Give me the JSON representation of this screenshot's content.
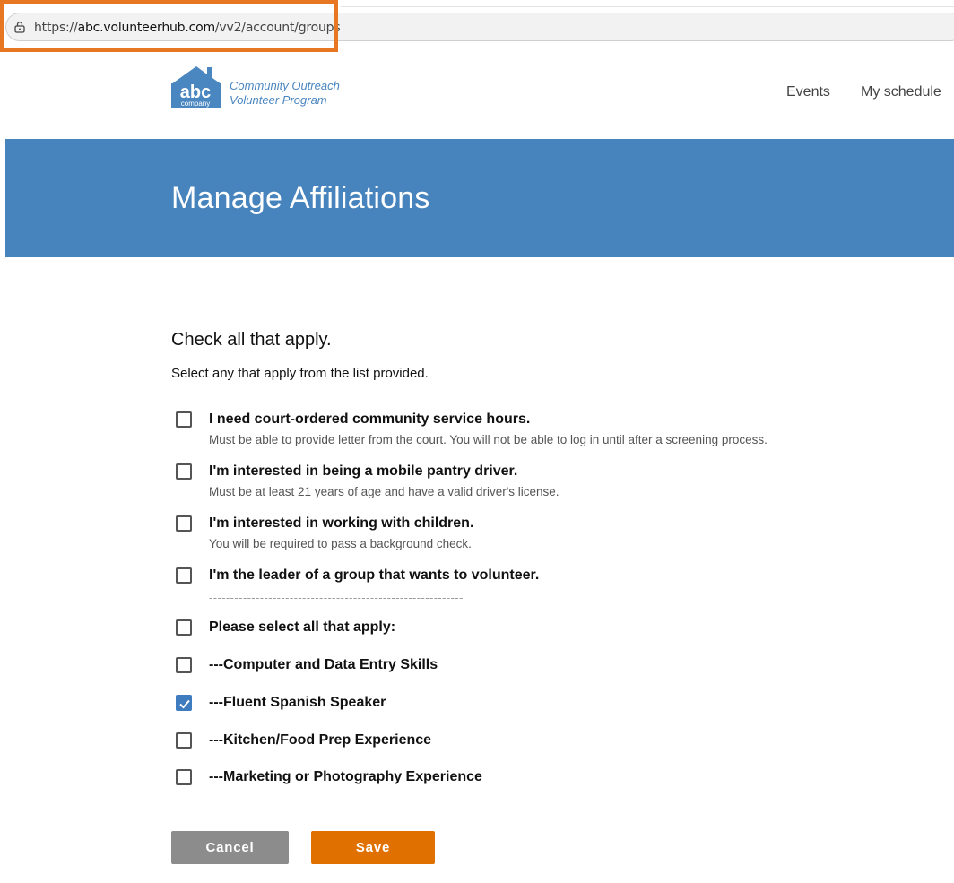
{
  "browser": {
    "url_prefix": "https://",
    "url_domain": "abc.volunteerhub.com",
    "url_path": "/vv2/account/groups",
    "lock_icon": "lock-icon"
  },
  "header": {
    "logo_text_top": "abc",
    "logo_text_bottom": "company",
    "brand_line1": "Community Outreach",
    "brand_line2": "Volunteer Program",
    "nav": [
      {
        "label": "Events"
      },
      {
        "label": "My schedule"
      }
    ]
  },
  "banner": {
    "title": "Manage Affiliations"
  },
  "form": {
    "heading": "Check all that apply.",
    "subtext": "Select any that apply from the list provided.",
    "options": [
      {
        "label": "I need court-ordered community service hours.",
        "hint": "Must be able to provide letter from the court. You will not be able to log in until after a screening process.",
        "checked": false
      },
      {
        "label": "I'm interested in being a mobile pantry driver.",
        "hint": "Must be at least 21 years of age and have a valid driver's license.",
        "checked": false
      },
      {
        "label": "I'm interested in working with children.",
        "hint": "You will be required to pass a background check.",
        "checked": false
      },
      {
        "label": "I'm the leader of a group that wants to volunteer.",
        "hint": "",
        "checked": false
      },
      {
        "label": "Please select all that apply:",
        "hint": "",
        "checked": false
      },
      {
        "label": "---Computer and Data Entry Skills",
        "hint": "",
        "checked": false
      },
      {
        "label": "---Fluent Spanish Speaker",
        "hint": "",
        "checked": true
      },
      {
        "label": "---Kitchen/Food Prep Experience",
        "hint": "",
        "checked": false
      },
      {
        "label": "---Marketing or Photography Experience",
        "hint": "",
        "checked": false
      }
    ],
    "separator": "------------------------------------------------------------"
  },
  "buttons": {
    "cancel": "Cancel",
    "save": "Save"
  },
  "colors": {
    "banner": "#4784bd",
    "save": "#e07000",
    "cancel": "#8c8c8c",
    "highlight": "#e87722",
    "checkbox_checked": "#3f7bbf"
  }
}
